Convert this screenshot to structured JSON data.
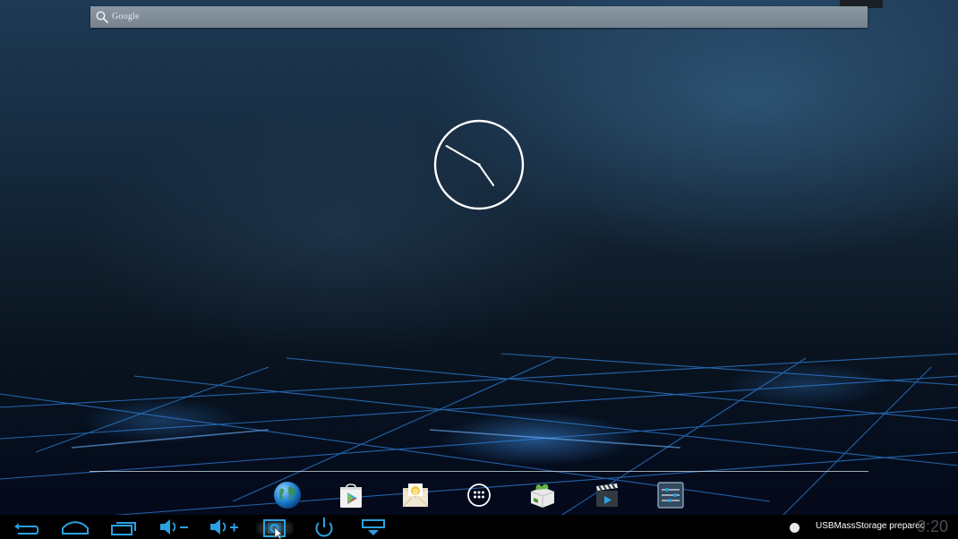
{
  "search": {
    "label": "Google",
    "icon": "search-icon"
  },
  "clock": {
    "hour": 4,
    "minute": 50
  },
  "dock": {
    "apps": [
      {
        "name": "browser",
        "icon": "globe-icon"
      },
      {
        "name": "play-store",
        "icon": "play-store-icon"
      },
      {
        "name": "email",
        "icon": "email-icon"
      },
      {
        "name": "all-apps",
        "icon": "app-drawer-icon"
      },
      {
        "name": "app-installer",
        "icon": "package-icon"
      },
      {
        "name": "video-player",
        "icon": "clapperboard-icon"
      },
      {
        "name": "settings",
        "icon": "settings-sliders-icon"
      }
    ]
  },
  "navbar": {
    "buttons": [
      "back",
      "home",
      "recent-apps",
      "volume-down",
      "volume-up",
      "screenshot",
      "power",
      "hide-bar"
    ]
  },
  "status": {
    "notification": "USBMassStorage prepared",
    "time": "9:20"
  },
  "colors": {
    "accent": "#2aa1e0",
    "wallpaper_dark": "#03071a"
  }
}
